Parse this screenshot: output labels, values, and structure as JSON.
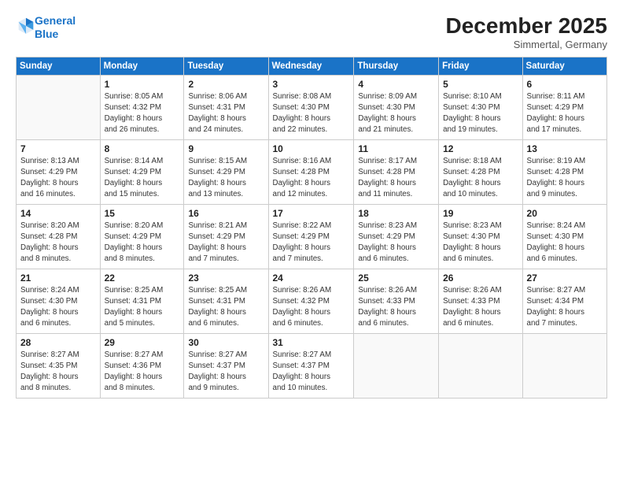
{
  "logo": {
    "line1": "General",
    "line2": "Blue"
  },
  "title": "December 2025",
  "location": "Simmertal, Germany",
  "days_header": [
    "Sunday",
    "Monday",
    "Tuesday",
    "Wednesday",
    "Thursday",
    "Friday",
    "Saturday"
  ],
  "weeks": [
    [
      {
        "day": "",
        "info": ""
      },
      {
        "day": "1",
        "info": "Sunrise: 8:05 AM\nSunset: 4:32 PM\nDaylight: 8 hours\nand 26 minutes."
      },
      {
        "day": "2",
        "info": "Sunrise: 8:06 AM\nSunset: 4:31 PM\nDaylight: 8 hours\nand 24 minutes."
      },
      {
        "day": "3",
        "info": "Sunrise: 8:08 AM\nSunset: 4:30 PM\nDaylight: 8 hours\nand 22 minutes."
      },
      {
        "day": "4",
        "info": "Sunrise: 8:09 AM\nSunset: 4:30 PM\nDaylight: 8 hours\nand 21 minutes."
      },
      {
        "day": "5",
        "info": "Sunrise: 8:10 AM\nSunset: 4:30 PM\nDaylight: 8 hours\nand 19 minutes."
      },
      {
        "day": "6",
        "info": "Sunrise: 8:11 AM\nSunset: 4:29 PM\nDaylight: 8 hours\nand 17 minutes."
      }
    ],
    [
      {
        "day": "7",
        "info": "Sunrise: 8:13 AM\nSunset: 4:29 PM\nDaylight: 8 hours\nand 16 minutes."
      },
      {
        "day": "8",
        "info": "Sunrise: 8:14 AM\nSunset: 4:29 PM\nDaylight: 8 hours\nand 15 minutes."
      },
      {
        "day": "9",
        "info": "Sunrise: 8:15 AM\nSunset: 4:29 PM\nDaylight: 8 hours\nand 13 minutes."
      },
      {
        "day": "10",
        "info": "Sunrise: 8:16 AM\nSunset: 4:28 PM\nDaylight: 8 hours\nand 12 minutes."
      },
      {
        "day": "11",
        "info": "Sunrise: 8:17 AM\nSunset: 4:28 PM\nDaylight: 8 hours\nand 11 minutes."
      },
      {
        "day": "12",
        "info": "Sunrise: 8:18 AM\nSunset: 4:28 PM\nDaylight: 8 hours\nand 10 minutes."
      },
      {
        "day": "13",
        "info": "Sunrise: 8:19 AM\nSunset: 4:28 PM\nDaylight: 8 hours\nand 9 minutes."
      }
    ],
    [
      {
        "day": "14",
        "info": "Sunrise: 8:20 AM\nSunset: 4:28 PM\nDaylight: 8 hours\nand 8 minutes."
      },
      {
        "day": "15",
        "info": "Sunrise: 8:20 AM\nSunset: 4:29 PM\nDaylight: 8 hours\nand 8 minutes."
      },
      {
        "day": "16",
        "info": "Sunrise: 8:21 AM\nSunset: 4:29 PM\nDaylight: 8 hours\nand 7 minutes."
      },
      {
        "day": "17",
        "info": "Sunrise: 8:22 AM\nSunset: 4:29 PM\nDaylight: 8 hours\nand 7 minutes."
      },
      {
        "day": "18",
        "info": "Sunrise: 8:23 AM\nSunset: 4:29 PM\nDaylight: 8 hours\nand 6 minutes."
      },
      {
        "day": "19",
        "info": "Sunrise: 8:23 AM\nSunset: 4:30 PM\nDaylight: 8 hours\nand 6 minutes."
      },
      {
        "day": "20",
        "info": "Sunrise: 8:24 AM\nSunset: 4:30 PM\nDaylight: 8 hours\nand 6 minutes."
      }
    ],
    [
      {
        "day": "21",
        "info": "Sunrise: 8:24 AM\nSunset: 4:30 PM\nDaylight: 8 hours\nand 6 minutes."
      },
      {
        "day": "22",
        "info": "Sunrise: 8:25 AM\nSunset: 4:31 PM\nDaylight: 8 hours\nand 5 minutes."
      },
      {
        "day": "23",
        "info": "Sunrise: 8:25 AM\nSunset: 4:31 PM\nDaylight: 8 hours\nand 6 minutes."
      },
      {
        "day": "24",
        "info": "Sunrise: 8:26 AM\nSunset: 4:32 PM\nDaylight: 8 hours\nand 6 minutes."
      },
      {
        "day": "25",
        "info": "Sunrise: 8:26 AM\nSunset: 4:33 PM\nDaylight: 8 hours\nand 6 minutes."
      },
      {
        "day": "26",
        "info": "Sunrise: 8:26 AM\nSunset: 4:33 PM\nDaylight: 8 hours\nand 6 minutes."
      },
      {
        "day": "27",
        "info": "Sunrise: 8:27 AM\nSunset: 4:34 PM\nDaylight: 8 hours\nand 7 minutes."
      }
    ],
    [
      {
        "day": "28",
        "info": "Sunrise: 8:27 AM\nSunset: 4:35 PM\nDaylight: 8 hours\nand 8 minutes."
      },
      {
        "day": "29",
        "info": "Sunrise: 8:27 AM\nSunset: 4:36 PM\nDaylight: 8 hours\nand 8 minutes."
      },
      {
        "day": "30",
        "info": "Sunrise: 8:27 AM\nSunset: 4:37 PM\nDaylight: 8 hours\nand 9 minutes."
      },
      {
        "day": "31",
        "info": "Sunrise: 8:27 AM\nSunset: 4:37 PM\nDaylight: 8 hours\nand 10 minutes."
      },
      {
        "day": "",
        "info": ""
      },
      {
        "day": "",
        "info": ""
      },
      {
        "day": "",
        "info": ""
      }
    ]
  ]
}
